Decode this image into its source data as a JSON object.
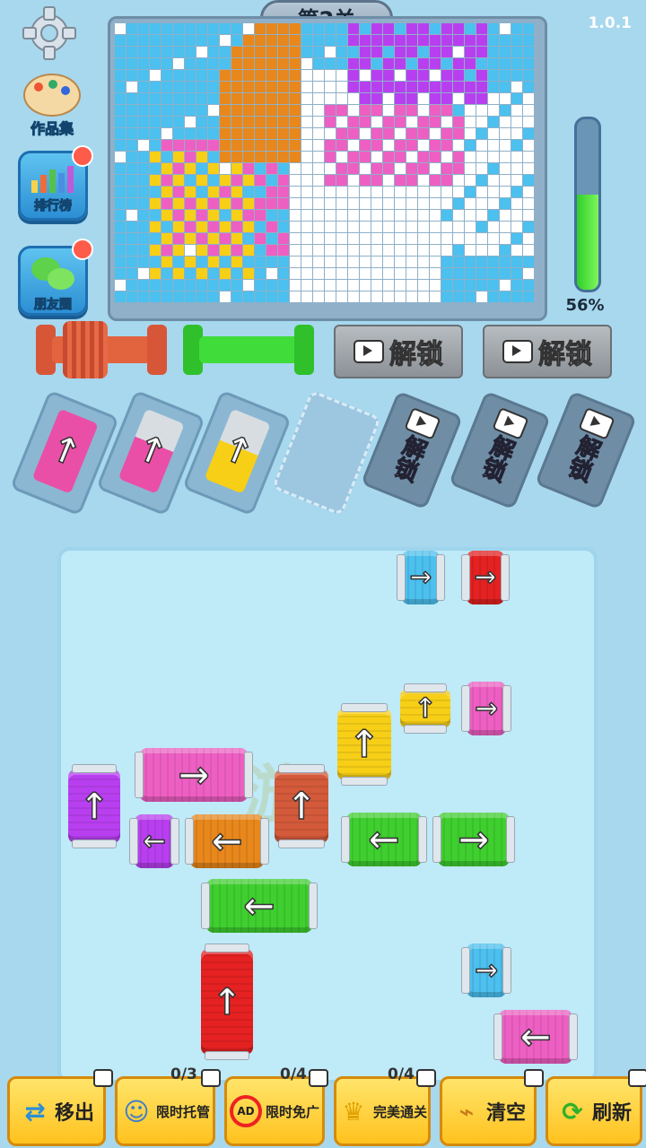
{
  "header": {
    "level_title": "第2关",
    "version": "1.0.1"
  },
  "menu": [
    {
      "label": "作品集",
      "icon": "palette-icon",
      "dot": false
    },
    {
      "label": "排行榜",
      "icon": "bar-chart-icon",
      "dot": true
    },
    {
      "label": "朋友圈",
      "icon": "wechat-icon",
      "dot": true
    }
  ],
  "progress": {
    "value": 0.56,
    "label": "56%"
  },
  "spool_slots": [
    {
      "state": "filled",
      "color": "#e2643f"
    },
    {
      "state": "empty",
      "color": "#3fdc3a"
    },
    {
      "state": "locked",
      "label": "解锁"
    },
    {
      "state": "locked",
      "label": "解锁"
    }
  ],
  "holding_cards": [
    {
      "state": "yarn",
      "color": "#ea4fa7",
      "arrow": "↑"
    },
    {
      "state": "yarn",
      "color": "#ea4fa7",
      "arrow": "↑"
    },
    {
      "state": "yarn",
      "color": "#f7cf17",
      "arrow": "↑"
    },
    {
      "state": "empty"
    },
    {
      "state": "locked",
      "label": "解锁"
    },
    {
      "state": "locked",
      "label": "解锁"
    },
    {
      "state": "locked",
      "label": "解锁"
    }
  ],
  "board": {
    "watermark": "游"
  },
  "toolbar": [
    {
      "label": "移出",
      "count": "",
      "icon": "move-out-icon"
    },
    {
      "label": "限时托管",
      "count": "0/3",
      "icon": "robot-icon"
    },
    {
      "label": "限时免广",
      "count": "0/4",
      "icon": "no-ad-icon"
    },
    {
      "label": "完美通关",
      "count": "0/4",
      "icon": "trophy-icon"
    },
    {
      "label": "清空",
      "count": "",
      "icon": "broom-icon"
    },
    {
      "label": "刷新",
      "count": "",
      "icon": "refresh-icon"
    }
  ],
  "colors": {
    "cyan": "#4cc0ef",
    "white": "#ffffff",
    "orange": "#e8871b",
    "purple": "#b83ff0",
    "pink": "#ee5fc3",
    "yellow": "#f7cf17",
    "red": "#e52121",
    "green": "#3fcf2f",
    "brown": "#d35a3a"
  }
}
